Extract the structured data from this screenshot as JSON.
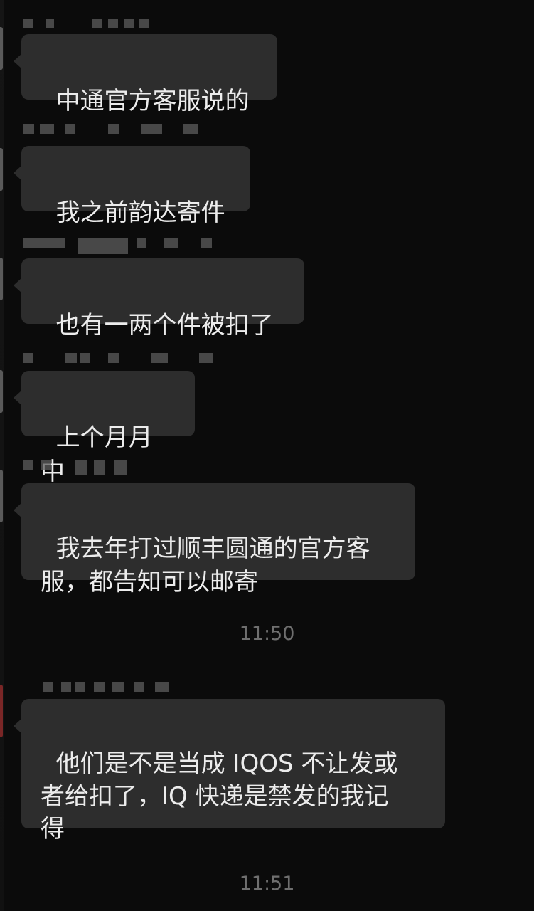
{
  "messages": [
    {
      "text": "中通官方客服说的"
    },
    {
      "text": "我之前韵达寄件"
    },
    {
      "text": "也有一两个件被扣了"
    },
    {
      "text": "上个月月中"
    },
    {
      "text": "我去年打过顺丰圆通的官方客\n服，都告知可以邮寄"
    },
    {
      "text": "他们是不是当成 IQOS 不让发或\n者给扣了，IQ 快递是禁发的我记\n得"
    }
  ],
  "timestamps": [
    "11:50",
    "11:51"
  ]
}
